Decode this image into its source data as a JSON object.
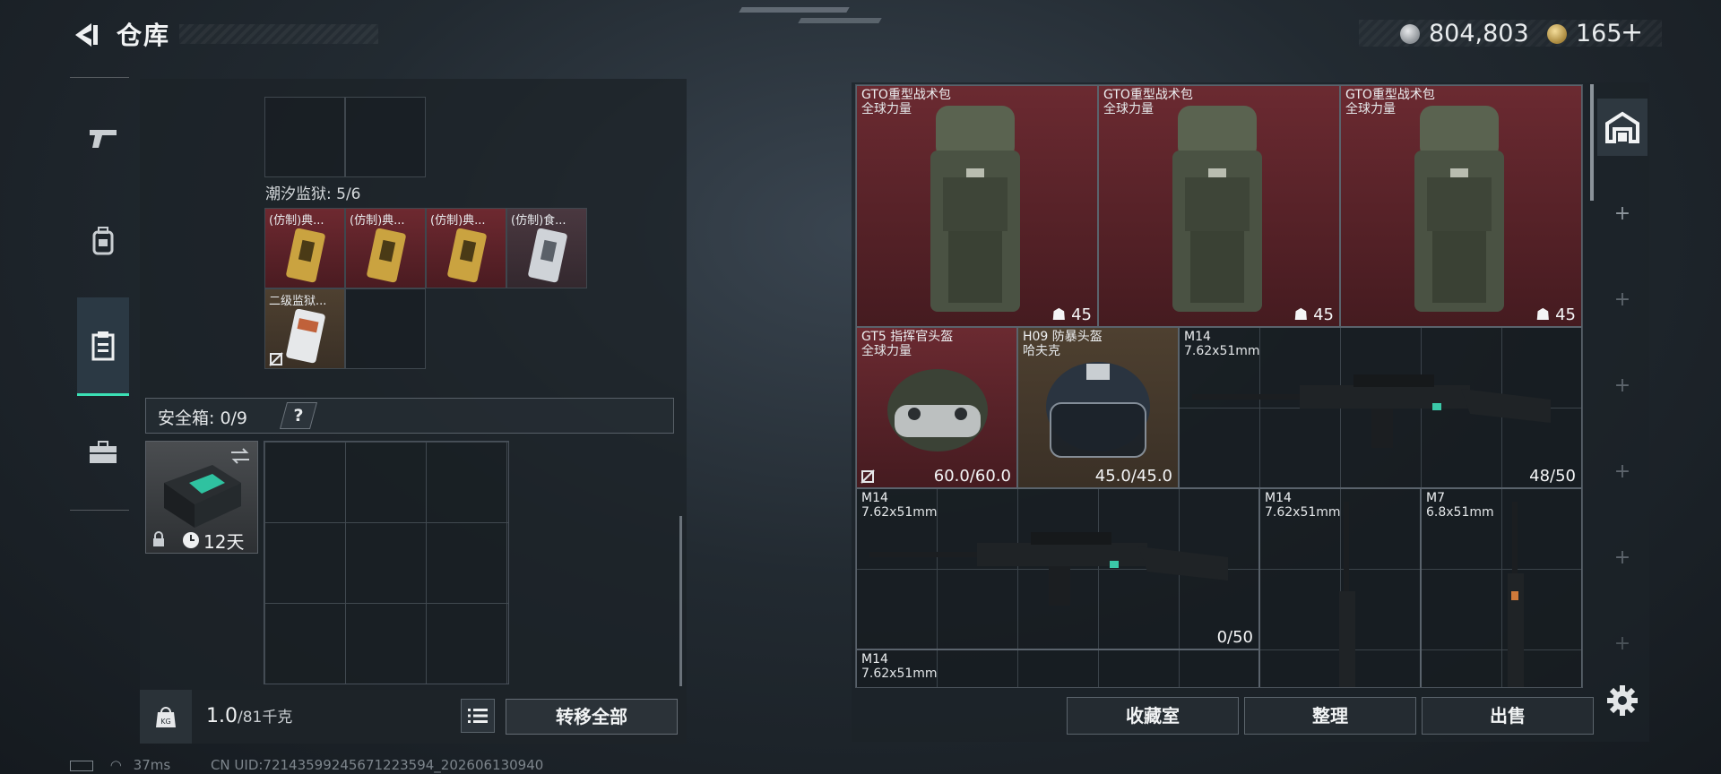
{
  "header": {
    "title": "仓库",
    "currency_silver": "804,803",
    "currency_gold": "165",
    "add_label": "+"
  },
  "left": {
    "section_label": "潮汐监狱: 5/6",
    "items_top": [
      {
        "label": "(仿制)典..."
      },
      {
        "label": "(仿制)典..."
      },
      {
        "label": "(仿制)典..."
      },
      {
        "label": "(仿制)食..."
      },
      {
        "label": "二级监狱..."
      }
    ],
    "safe_box_label": "安全箱: 0/9",
    "safe_help": "?",
    "safe_item_timer": "12天",
    "weight_value": "1.0",
    "weight_capacity": "/81千克",
    "transfer_all": "转移全部"
  },
  "inventory": {
    "items": [
      {
        "name": "GTO重型战术包",
        "brand": "全球力量",
        "value": "45"
      },
      {
        "name": "GTO重型战术包",
        "brand": "全球力量",
        "value": "45"
      },
      {
        "name": "GTO重型战术包",
        "brand": "全球力量",
        "value": "45"
      },
      {
        "name": "GT5 指挥官头盔",
        "brand": "全球力量",
        "value": "60.0/60.0"
      },
      {
        "name": "H09 防暴头盔",
        "brand": "哈夫克",
        "value": "45.0/45.0"
      },
      {
        "name": "M14",
        "brand": "7.62x51mm",
        "value": "48/50"
      },
      {
        "name": "M14",
        "brand": "7.62x51mm",
        "value": "0/50"
      },
      {
        "name": "M14",
        "brand": "7.62x51mm",
        "value": ""
      },
      {
        "name": "M7",
        "brand": "6.8x51mm",
        "value": ""
      },
      {
        "name": "M14",
        "brand": "7.62x51mm",
        "value": ""
      }
    ],
    "buttons": {
      "collection": "收藏室",
      "organize": "整理",
      "sell": "出售"
    }
  },
  "status": {
    "ping": "37ms",
    "uid": "CN UID:72143599245671223594_202606130940"
  },
  "colors": {
    "accent": "#3be0b5",
    "item_red": "#6b2a31",
    "panel": "#1c2228"
  }
}
